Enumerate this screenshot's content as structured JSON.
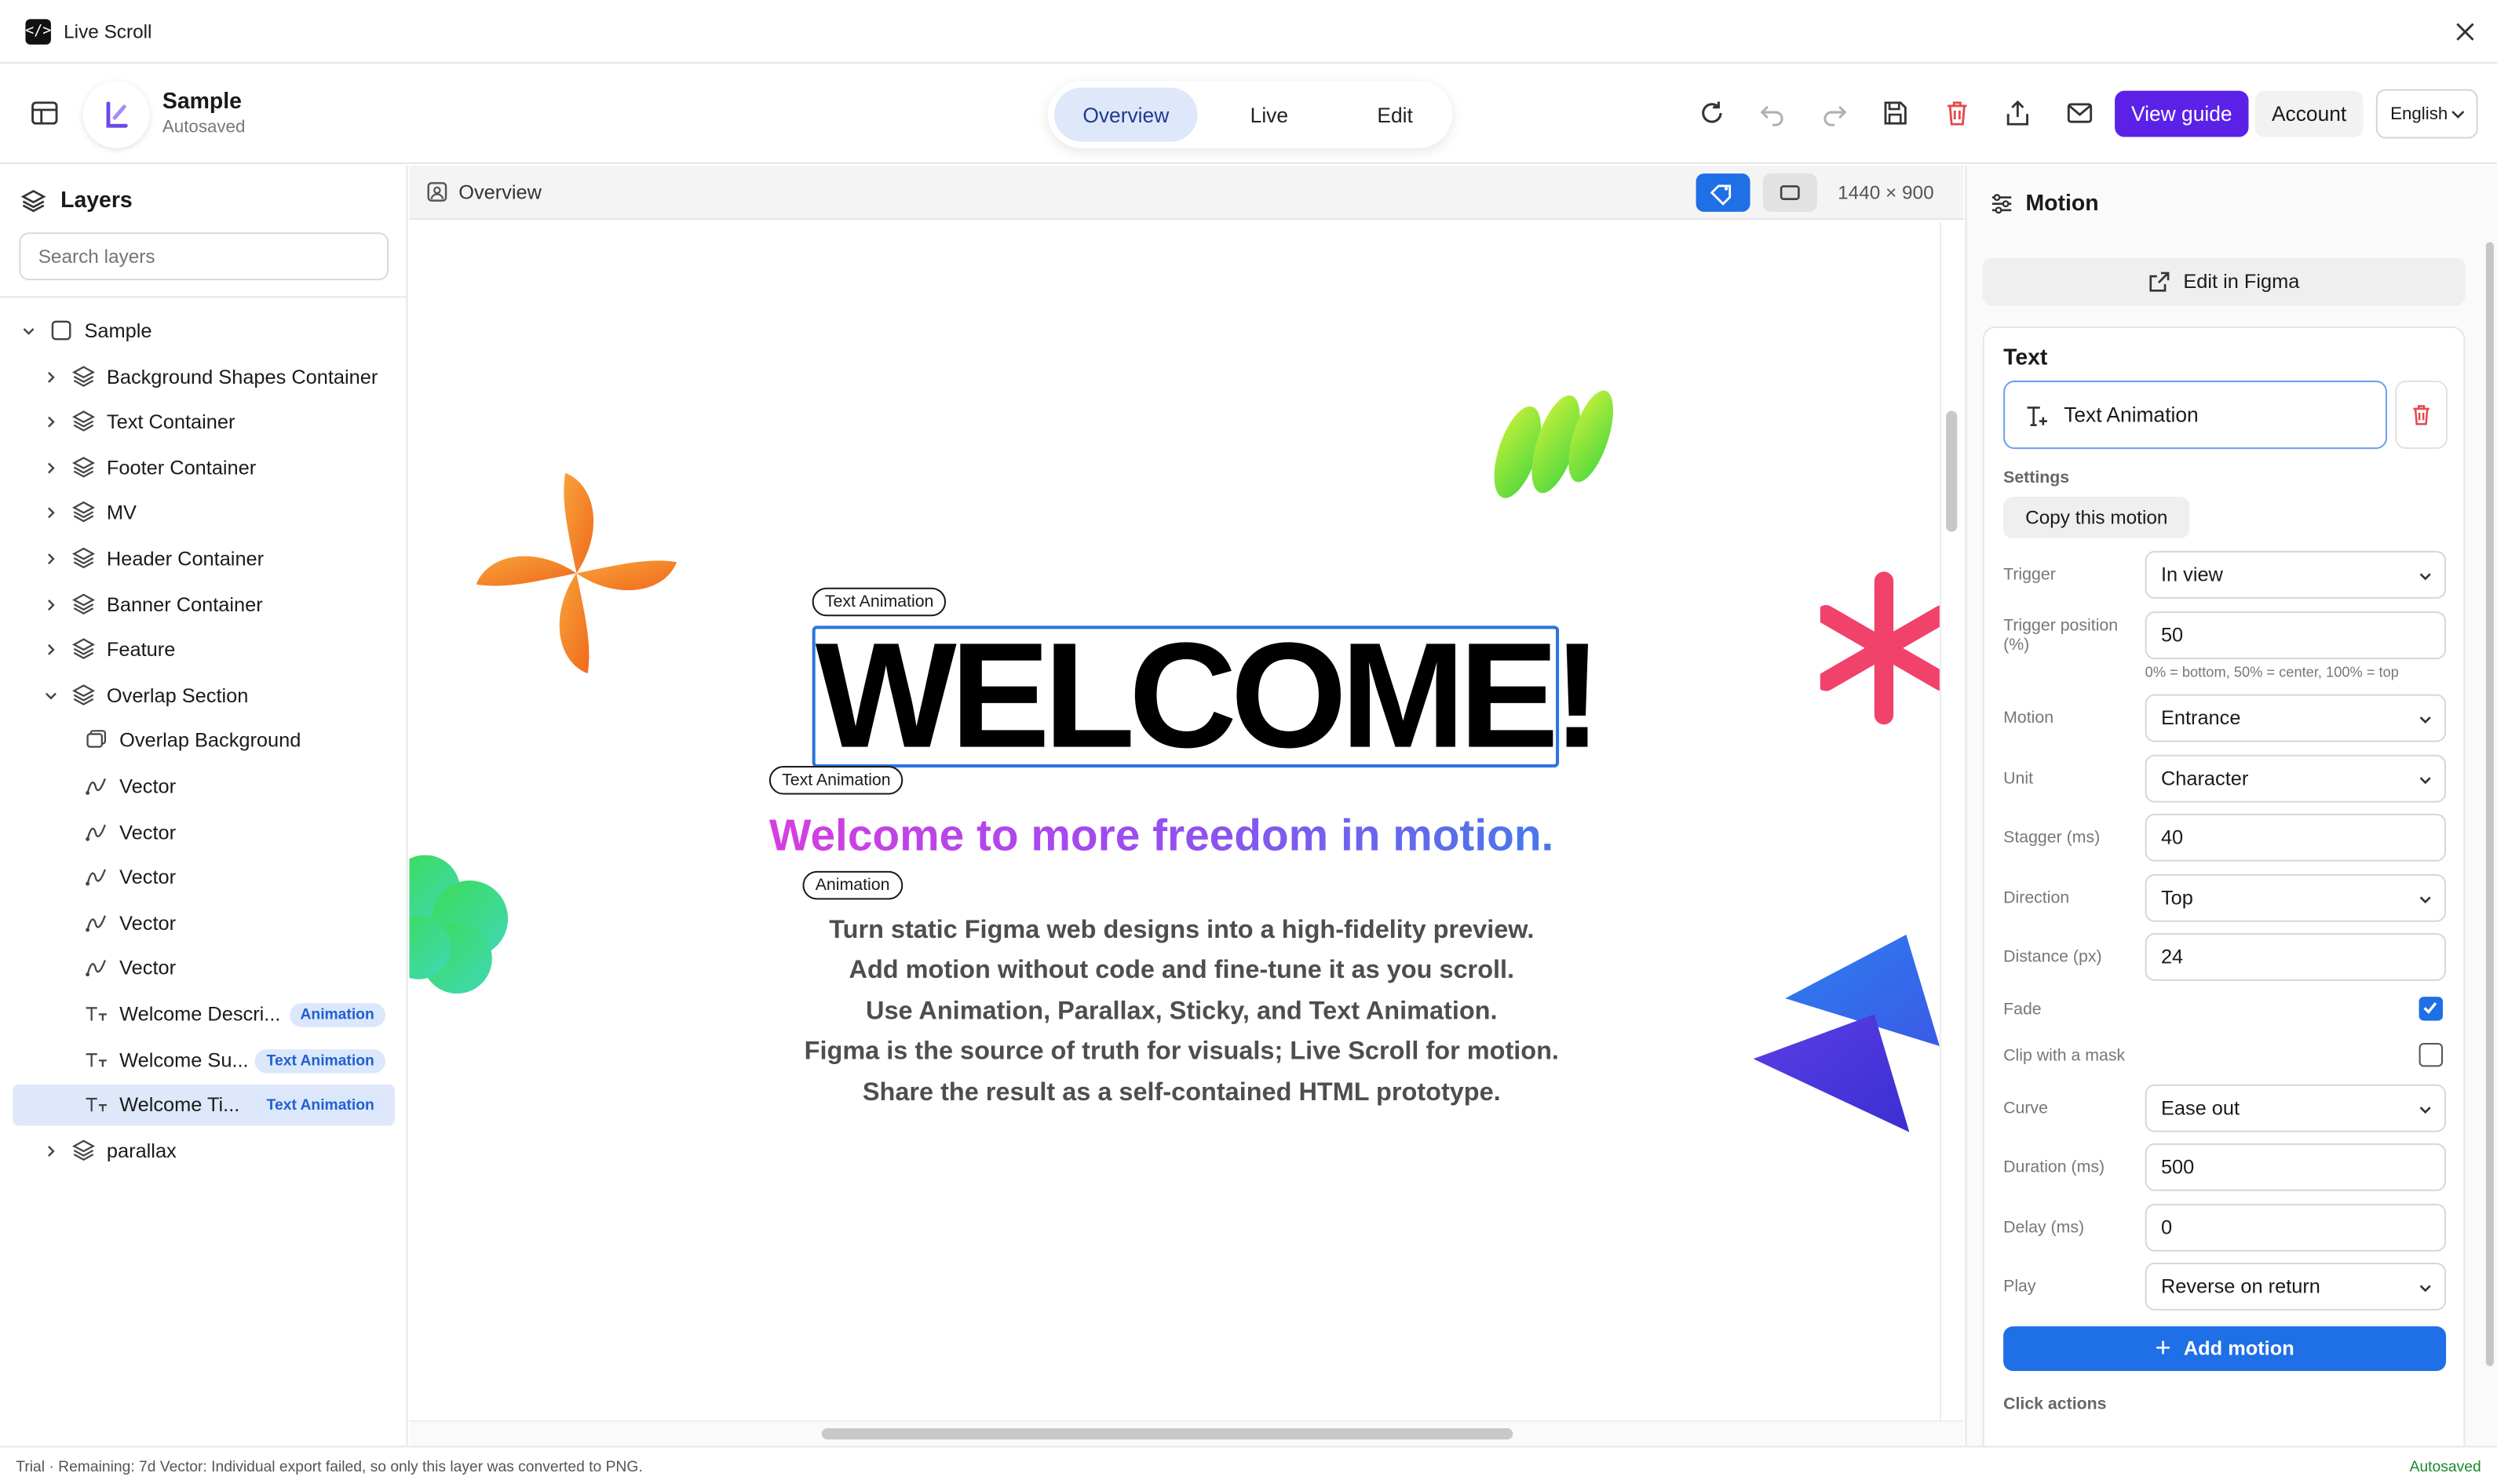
{
  "window": {
    "title": "Live Scroll",
    "icon_glyph": "</>"
  },
  "project": {
    "name": "Sample",
    "status": "Autosaved"
  },
  "mode_tabs": [
    {
      "label": "Overview",
      "active": true
    },
    {
      "label": "Live",
      "active": false
    },
    {
      "label": "Edit",
      "active": false
    }
  ],
  "toolbar": {
    "icons": [
      "refresh-icon",
      "undo-icon",
      "redo-icon",
      "save-icon",
      "trash-icon",
      "share-icon",
      "mail-icon"
    ],
    "view_guide_label": "View guide",
    "account_label": "Account",
    "language": "English"
  },
  "layers_panel": {
    "title": "Layers",
    "search_placeholder": "Search layers",
    "items": [
      {
        "label": "Sample",
        "level": 0,
        "expanded": true,
        "icon": "frame-icon"
      },
      {
        "label": "Background Shapes Container",
        "level": 1,
        "icon": "layers-icon"
      },
      {
        "label": "Text Container",
        "level": 1,
        "icon": "layers-icon"
      },
      {
        "label": "Footer Container",
        "level": 1,
        "icon": "layers-icon"
      },
      {
        "label": "MV",
        "level": 1,
        "icon": "layers-icon"
      },
      {
        "label": "Header Container",
        "level": 1,
        "icon": "layers-icon"
      },
      {
        "label": "Banner Container",
        "level": 1,
        "icon": "layers-icon"
      },
      {
        "label": "Feature",
        "level": 1,
        "icon": "layers-icon"
      },
      {
        "label": "Overlap Section",
        "level": 1,
        "expanded": true,
        "icon": "layers-icon"
      },
      {
        "label": "Overlap Background",
        "level": 2,
        "icon": "rectangle-icon"
      },
      {
        "label": "Vector",
        "level": 2,
        "icon": "vector-icon"
      },
      {
        "label": "Vector",
        "level": 2,
        "icon": "vector-icon"
      },
      {
        "label": "Vector",
        "level": 2,
        "icon": "vector-icon"
      },
      {
        "label": "Vector",
        "level": 2,
        "icon": "vector-icon"
      },
      {
        "label": "Vector",
        "level": 2,
        "icon": "vector-icon"
      },
      {
        "label": "Welcome Descri...",
        "level": 2,
        "icon": "text-icon",
        "badge": "Animation"
      },
      {
        "label": "Welcome Su...",
        "level": 2,
        "icon": "text-icon",
        "badge": "Text Animation"
      },
      {
        "label": "Welcome Ti...",
        "level": 2,
        "icon": "text-icon",
        "badge": "Text Animation",
        "selected": true
      },
      {
        "label": "parallax",
        "level": 1,
        "icon": "layers-icon"
      }
    ]
  },
  "canvas": {
    "header_label": "Overview",
    "size_label": "1440 × 900",
    "tags": {
      "title_tag": "Text Animation",
      "subtitle_tag": "Text Animation",
      "desc_tag": "Animation"
    },
    "welcome_title": "WELCOME!",
    "subtitle": "Welcome to more freedom in motion.",
    "description_lines": [
      "Turn static Figma web designs into a high-fidelity preview.",
      "Add motion without code and fine-tune it as you scroll.",
      "Use Animation, Parallax, Sticky, and Text Animation.",
      "Figma is the source of truth for visuals; Live Scroll for motion.",
      "Share the result as a self-contained HTML prototype."
    ]
  },
  "motion_panel": {
    "title": "Motion",
    "edit_in_figma_label": "Edit in Figma",
    "section_title": "Text",
    "selected_motion": "Text Animation",
    "settings_label": "Settings",
    "copy_motion_label": "Copy this motion",
    "fields": {
      "trigger": {
        "label": "Trigger",
        "value": "In view"
      },
      "trigger_position": {
        "label": "Trigger position (%)",
        "value": "50",
        "hint": "0% = bottom, 50% = center, 100% = top"
      },
      "motion": {
        "label": "Motion",
        "value": "Entrance"
      },
      "unit": {
        "label": "Unit",
        "value": "Character"
      },
      "stagger": {
        "label": "Stagger (ms)",
        "value": "40"
      },
      "direction": {
        "label": "Direction",
        "value": "Top"
      },
      "distance": {
        "label": "Distance (px)",
        "value": "24"
      },
      "fade": {
        "label": "Fade",
        "checked": true
      },
      "clip_mask": {
        "label": "Clip with a mask",
        "checked": false
      },
      "curve": {
        "label": "Curve",
        "value": "Ease out"
      },
      "duration": {
        "label": "Duration (ms)",
        "value": "500"
      },
      "delay": {
        "label": "Delay (ms)",
        "value": "0"
      },
      "play": {
        "label": "Play",
        "value": "Reverse on return"
      }
    },
    "add_motion_label": "Add motion",
    "click_actions_label": "Click actions"
  },
  "statusbar": {
    "left_text": "Trial · Remaining: 7d    Vector: Individual export failed, so only this layer was converted to PNG.",
    "right_text": "Autosaved"
  },
  "colors": {
    "accent_blue": "#1f6fe6",
    "guide_purple": "#5b21e6",
    "status_green": "#1a8a2a",
    "delete_red": "#e5484d"
  }
}
